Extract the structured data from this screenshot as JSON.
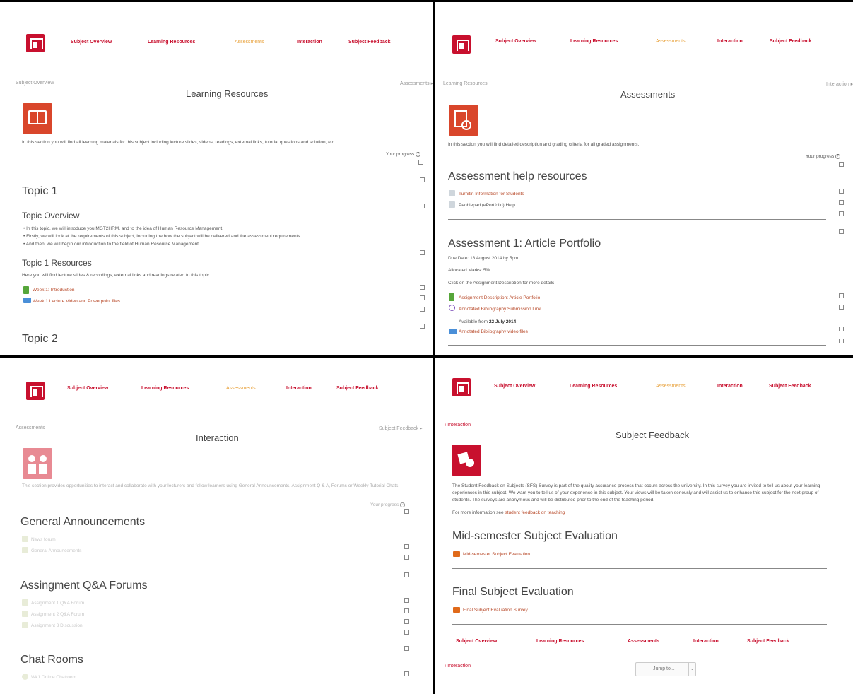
{
  "nav": [
    "Subject Overview",
    "Learning Resources",
    "Assessments",
    "Interaction",
    "Subject Feedback"
  ],
  "learning": {
    "crumb_prev": "Subject Overview",
    "crumb_next": "Assessments ▸",
    "title": "Learning Resources",
    "intro": "In this section you will find all learning materials for this subject including lecture slides, videos, readings, external links, tutorial questions and solution, etc.",
    "progress_label": "Your progress",
    "topic1_heading": "Topic 1",
    "topic_overview_heading": "Topic Overview",
    "bullets": [
      "In this topic, we will introduce you MGT2HRM, and to the idea of Human Resource Management.",
      "Firstly, we will look at the requirements of this subject, including the how the subject will be delivered and the assessment requirements.",
      "And then, we will begin our introduction to the field of Human Resource Management."
    ],
    "resources_heading": "Topic 1 Resources",
    "resources_intro": "Here you will find lecture slides & recordings, external links and readings related to this topic.",
    "items": [
      "Week 1: Introduction",
      "Week 1 Lecture Video and Powerpoint files"
    ],
    "topic2_heading": "Topic 2"
  },
  "assessments": {
    "crumb_prev": "Learning Resources",
    "crumb_next": "Interaction ▸",
    "title": "Assessments",
    "intro": "In this section you will find detailed description and grading criteria for all graded assignments.",
    "progress_label": "Your progress",
    "help_heading": "Assessment help resources",
    "help_items": [
      "Turnitin Information for Students",
      "Peoblepad (ePortfolio) Help"
    ],
    "a1_heading": "Assessment 1: Article Portfolio",
    "due": "Due Date: 18 August 2014 by 5pm",
    "marks": "Allocated Marks: 5%",
    "click_note": "Click on the Assignment Description for more details",
    "a1_items": [
      "Assignment Description: Article Portfolio",
      "Annotated Bibliography Submission Link",
      "Annotated Bibliography video files"
    ],
    "available_prefix": "Available from",
    "available_date": "22 July 2014"
  },
  "interaction": {
    "crumb_prev": "Assessments",
    "crumb_next": "Subject Feedback ▸",
    "title": "Interaction",
    "intro": "This section provides opportunities to interact and collaborate with your lecturers and fellow learners using General Announcements, Assignment Q & A, Forums or Weekly Tutorial Chats.",
    "progress_label": "Your progress",
    "general_heading": "General Announcements",
    "general_items": [
      "News forum",
      "General Announcements"
    ],
    "qa_heading": "Assingment Q&A Forums",
    "qa_items": [
      "Assignment 1 Q&A Forum",
      "Assignment 2 Q&A Forum",
      "Assignment 3 Discussion"
    ],
    "chat_heading": "Chat Rooms",
    "chat_items": [
      "Wk1 Online Chatroom"
    ]
  },
  "feedback": {
    "crumb_prev": "Interaction",
    "title": "Subject Feedback",
    "para_lines": [
      "The Student Feedback on Subjects (SFS) Survey is part of the quality assurance process that occurs across the university.  In this survey you are invited to tell us about your learning",
      "experiences in this subject.  We want you to tell us of your experience in this subject.  Your views will be taken seriously and will assist us to enhance this subject for the next group of",
      "students.  The surveys are anonymous and will be distributed prior to the end of the teaching period."
    ],
    "more_info_prefix": "For more information see",
    "more_info_link": "student feedback on teaching",
    "mid_heading": "Mid-semester Subject Evaluation",
    "mid_item": "Mid-semester Subject Evaluation",
    "final_heading": "Final Subject Evaluation",
    "final_item": "Final Subject Evaluation Survey",
    "footer_crumb": "Interaction",
    "jump_label": "Jump to..."
  },
  "colors": {
    "brand": "#c8102e",
    "active": "#e8a13a"
  }
}
